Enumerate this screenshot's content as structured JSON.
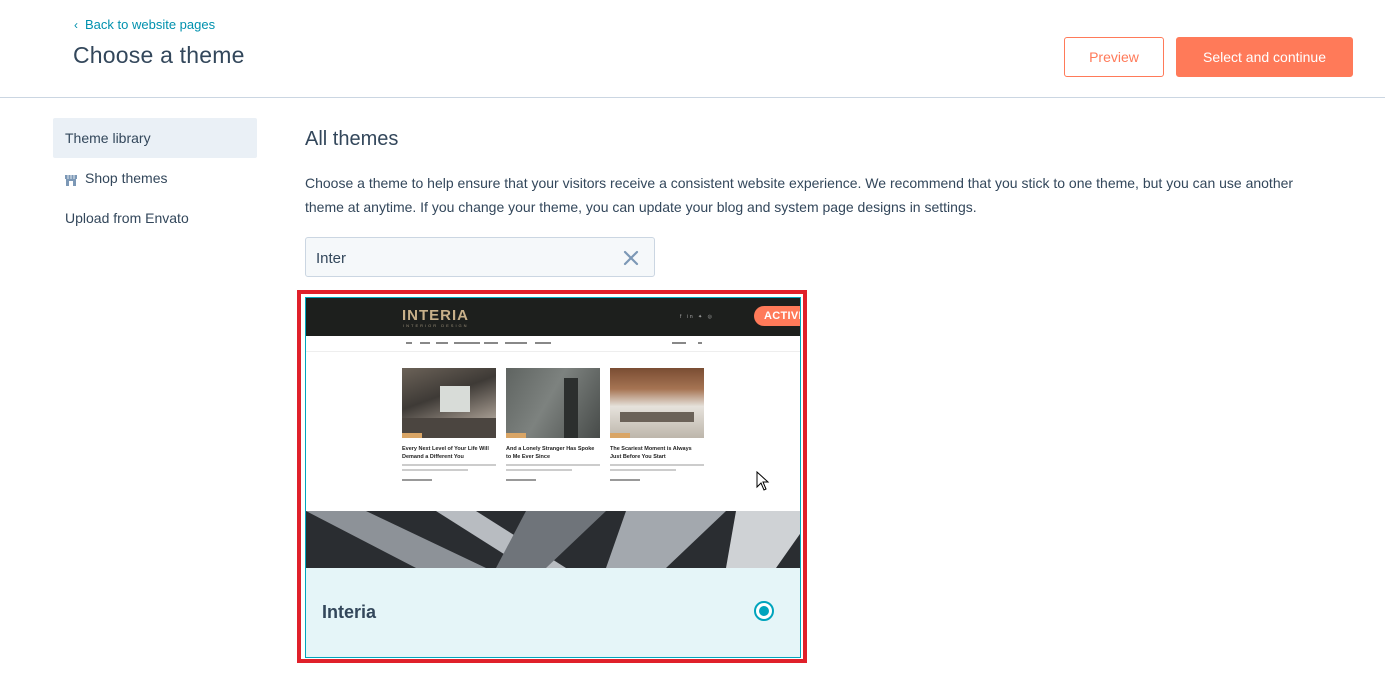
{
  "header": {
    "back_label": "Back to website pages",
    "title": "Choose a theme",
    "preview_label": "Preview",
    "select_label": "Select and continue"
  },
  "colors": {
    "accent": "#ff7a59",
    "link": "#0091ae",
    "selected": "#00a4bd",
    "text": "#33475b",
    "highlight_border": "#e0202a"
  },
  "sidebar": {
    "items": [
      {
        "label": "Theme library",
        "active": true
      },
      {
        "label": "Shop themes",
        "icon": "store-icon"
      },
      {
        "label": "Upload from Envato"
      }
    ]
  },
  "main": {
    "section_title": "All themes",
    "description": "Choose a theme to help ensure that your visitors receive a consistent website experience. We recommend that you stick to one theme, but you can use another theme at anytime. If you change your theme, you can update your blog and system page designs in settings.",
    "search": {
      "value": "Inter"
    }
  },
  "theme_card": {
    "name": "Interia",
    "badge": "ACTIVE",
    "selected": true,
    "preview": {
      "logo": "INTERIA",
      "tagline": "INTERIOR DESIGN",
      "posts": [
        {
          "title": "Every Next Level of Your Life Will Demand a Different You"
        },
        {
          "title": "And a Lonely Stranger Has Spoke to Me Ever Since"
        },
        {
          "title": "The Scariest Moment is Always Just Before You Start"
        }
      ]
    }
  }
}
